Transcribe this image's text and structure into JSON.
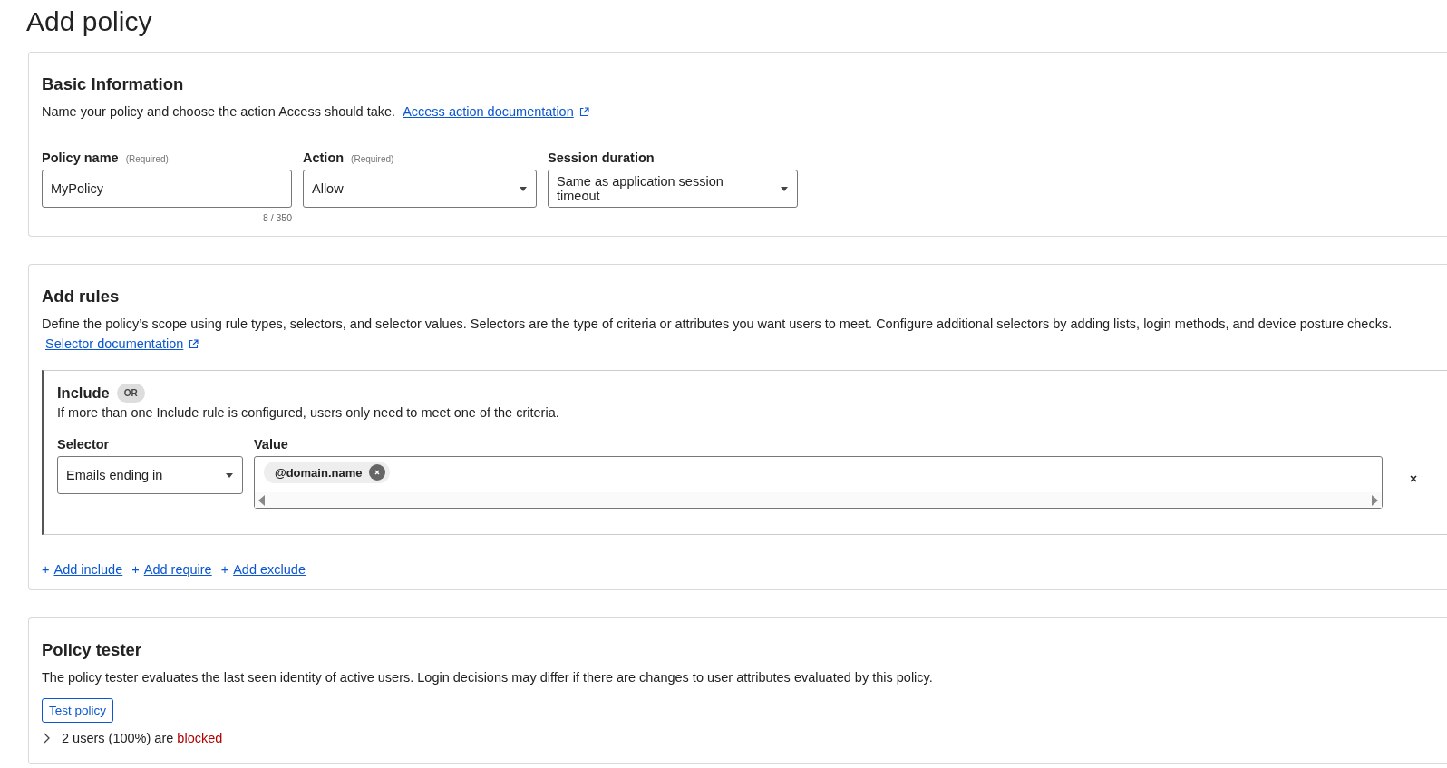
{
  "page_title": "Add policy",
  "basic_information": {
    "title": "Basic Information",
    "description": "Name your policy and choose the action Access should take.",
    "link": "Access action documentation",
    "fields": [
      {
        "kind": "text",
        "label": "Policy name",
        "hint": "(Required)",
        "value": "MyPolicy",
        "counter": "8 / 350"
      },
      {
        "kind": "select",
        "label": "Action",
        "hint": "(Required)",
        "value": "Allow"
      },
      {
        "kind": "select",
        "label": "Session duration",
        "value": "Same as application session timeout"
      }
    ]
  },
  "add_rules": {
    "title": "Add rules",
    "description": "Define the policy’s scope using rule types, selectors, and selector values. Selectors are the type of criteria or attributes you want users to meet. Configure additional selectors by adding lists, login methods, and device posture checks.",
    "link": "Selector documentation",
    "include": {
      "title": "Include",
      "badge": "OR",
      "description": "If more than one Include rule is configured, users only need to meet one of the criteria.",
      "selector_label": "Selector",
      "value_label": "Value",
      "selector": "Emails ending in",
      "tags": [
        "@domain.name"
      ]
    },
    "add_links": [
      {
        "icon": "+",
        "label": "Add include"
      },
      {
        "icon": "+",
        "label": "Add require"
      },
      {
        "icon": "+",
        "label": "Add exclude"
      }
    ]
  },
  "policy_tester": {
    "title": "Policy tester",
    "description": "The policy tester evaluates the last seen identity of active users. Login decisions may differ if there are changes to user attributes evaluated by this policy.",
    "button": "Test policy",
    "result": {
      "expanded": false,
      "text": "2 users (100%) are",
      "status": "blocked"
    }
  }
}
